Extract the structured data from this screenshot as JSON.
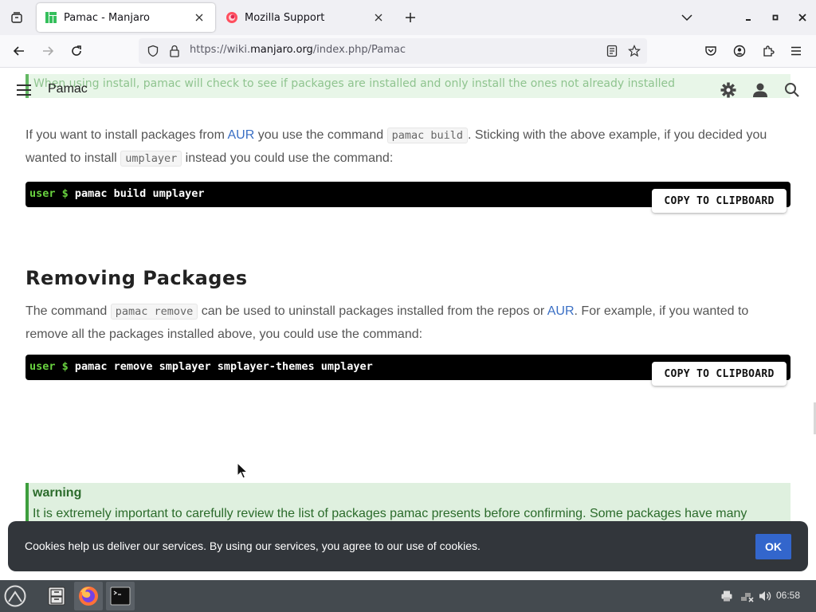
{
  "browser": {
    "tabs": [
      {
        "title": "Pamac - Manjaro",
        "active": true
      },
      {
        "title": "Mozilla Support",
        "active": false
      }
    ],
    "url_prefix": "https://wiki.",
    "url_domain": "manjaro.org",
    "url_path": "/index.php/Pamac"
  },
  "site": {
    "title": "Pamac",
    "ghost_note": "When using install, pamac will check to see if packages are installed and only install the ones not already installed"
  },
  "content": {
    "aur_para": {
      "t1": "If you want to install packages from ",
      "link1": "AUR",
      "t2": " you use the command ",
      "code1": "pamac build",
      "t3": ". Sticking with the above example, if you decided you wanted to install ",
      "code2": "umplayer",
      "t4": " instead you could use the command:"
    },
    "code_build": {
      "prompt": "user $",
      "command": " pamac build umplayer"
    },
    "copy_label": "COPY TO CLIPBOARD",
    "removing_heading": "Removing Packages",
    "remove_para": {
      "t1": "The command ",
      "code1": "pamac remove",
      "t2": " can be used to uninstall packages installed from the repos or ",
      "link1": "AUR",
      "t3": ". For example, if you wanted to remove all the packages installed above, you could use the command:"
    },
    "code_remove": {
      "prompt": "user $",
      "command": " pamac remove smplayer smplayer-themes umplayer"
    },
    "warning": {
      "title": "warning",
      "text": "It is extremely important to carefully review the list of packages pamac presents before confirming. Some packages have many"
    }
  },
  "cookie": {
    "text": "Cookies help us deliver our services. By using our services, you agree to our use of cookies.",
    "ok_label": "OK"
  },
  "taskbar": {
    "clock": "06:58"
  },
  "colors": {
    "prompt_green": "#68d13f",
    "link_blue": "#3a6fc4",
    "ok_blue": "#3366cc",
    "warn_green": "#2b6b2b"
  }
}
